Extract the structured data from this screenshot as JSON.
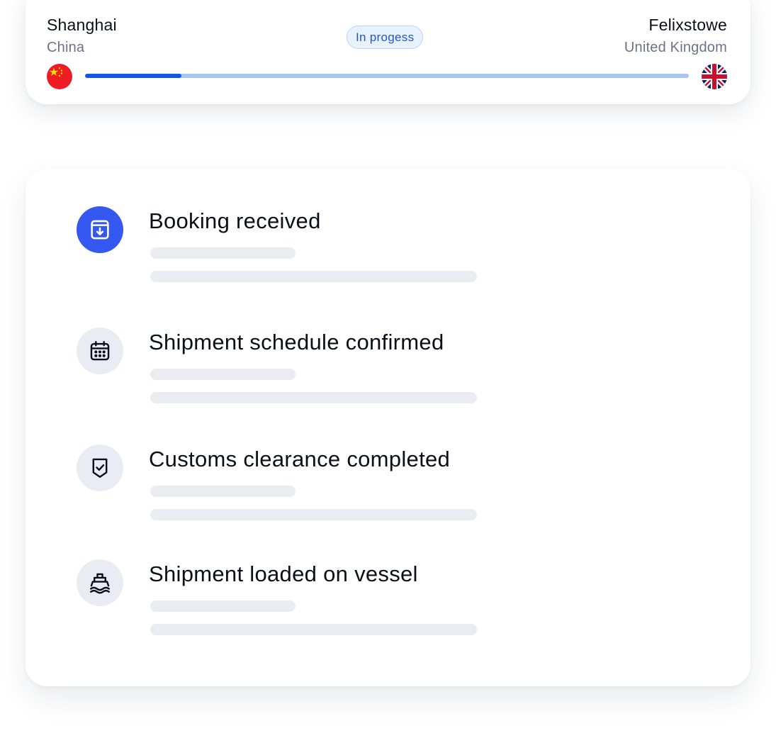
{
  "route": {
    "origin": {
      "city": "Shanghai",
      "country": "China",
      "flag_icon": "china-flag-icon"
    },
    "destination": {
      "city": "Felixstowe",
      "country": "United Kingdom",
      "flag_icon": "uk-flag-icon"
    },
    "status": "In progess",
    "progress_fraction": 0.16
  },
  "colors": {
    "accent": "#1456E6",
    "progress_track": "#A9C5F4",
    "badge_background": "#E8F2FD",
    "badge_text": "#1F57C9",
    "active_step": "#3458F0",
    "inactive_step": "#E9EDF3",
    "skeleton": "#E9EDF2"
  },
  "steps": [
    {
      "title": "Booking received",
      "icon": "archive-download-icon",
      "active": true
    },
    {
      "title": "Shipment schedule confirmed",
      "icon": "calendar-icon",
      "active": false
    },
    {
      "title": "Customs clearance completed",
      "icon": "shield-check-icon",
      "active": false
    },
    {
      "title": "Shipment loaded on vessel",
      "icon": "ship-icon",
      "active": false
    }
  ]
}
